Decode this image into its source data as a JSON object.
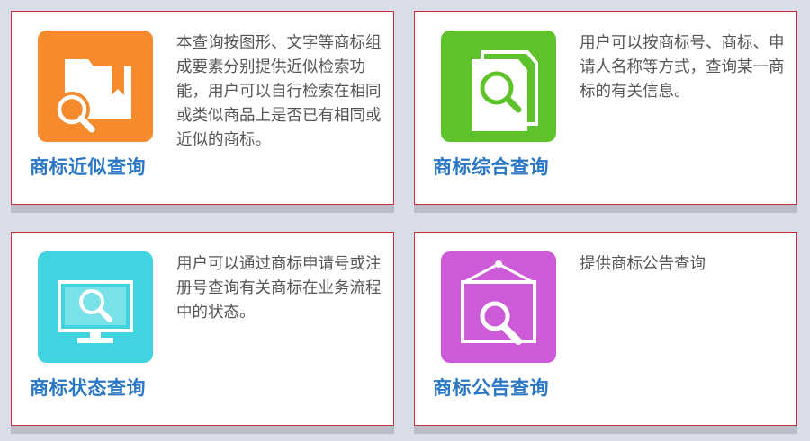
{
  "colors": {
    "background": "#d9dde8",
    "card_border": "#c8323a",
    "title": "#2a77c5",
    "text": "#555555",
    "tile_orange": "#f48a2c",
    "tile_green": "#5ec32a",
    "tile_cyan": "#3fd4df",
    "tile_magenta": "#cd5ad6"
  },
  "cards": [
    {
      "title": "商标近似查询",
      "description": "本查询按图形、文字等商标组成要素分别提供近似检索功能，用户可以自行检索在相同或类似商品上是否已有相同或近似的商标。",
      "icon": "folder-search-icon"
    },
    {
      "title": "商标综合查询",
      "description": "用户可以按商标号、商标、申请人名称等方式，查询某一商标的有关信息。",
      "icon": "document-search-icon"
    },
    {
      "title": "商标状态查询",
      "description": "用户可以通过商标申请号或注册号查询有关商标在业务流程中的状态。",
      "icon": "monitor-search-icon"
    },
    {
      "title": "商标公告查询",
      "description": "提供商标公告查询",
      "icon": "frame-search-icon"
    }
  ]
}
